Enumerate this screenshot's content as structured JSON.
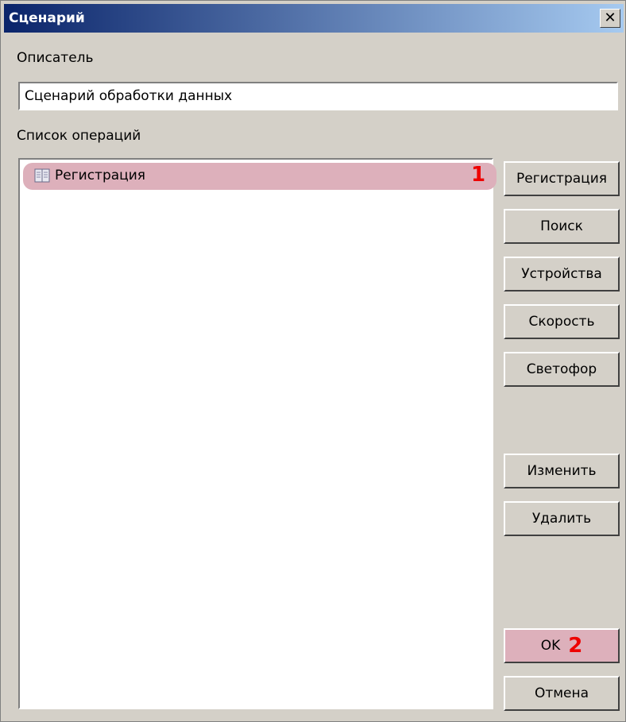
{
  "window": {
    "title": "Сценарий"
  },
  "descriptor": {
    "label": "Описатель",
    "value": "Сценарий обработки данных"
  },
  "operations": {
    "label": "Список операций",
    "items": [
      {
        "label": "Регистрация",
        "icon": "registration-icon",
        "marker": "1"
      }
    ]
  },
  "buttons": {
    "registration": "Регистрация",
    "search": "Поиск",
    "devices": "Устройства",
    "speed": "Скорость",
    "traffic_light": "Светофор",
    "edit": "Изменить",
    "delete": "Удалить",
    "ok": "OK",
    "cancel": "Отмена"
  },
  "markers": {
    "ok_marker": "2"
  },
  "colors": {
    "title_start": "#0a246a",
    "title_end": "#a6caf0",
    "highlight": "#ddb0bb",
    "marker": "#ee0000"
  }
}
